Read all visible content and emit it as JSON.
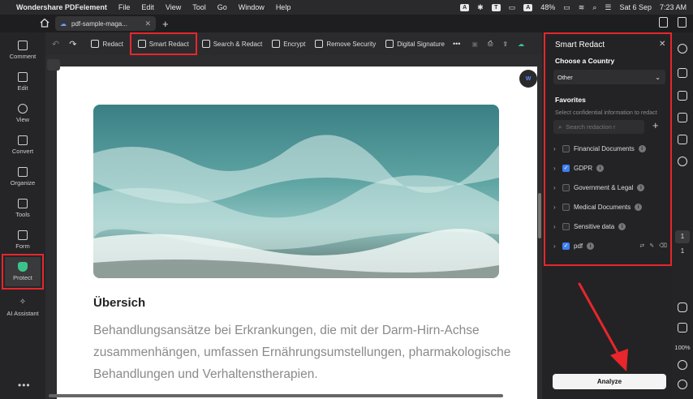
{
  "menubar": {
    "app": "Wondershare PDFelement",
    "items": [
      "File",
      "Edit",
      "View",
      "Tool",
      "Go",
      "Window",
      "Help"
    ],
    "status_a": "A",
    "battery": "48%",
    "datetime_day": "Sat 6 Sep",
    "datetime_time": "7:23 AM"
  },
  "tab": {
    "title": "pdf-sample-maga...",
    "close": "✕",
    "new": "+"
  },
  "sidebar": [
    {
      "label": "Comment"
    },
    {
      "label": "Edit"
    },
    {
      "label": "View"
    },
    {
      "label": "Convert"
    },
    {
      "label": "Organize"
    },
    {
      "label": "Tools"
    },
    {
      "label": "Form"
    },
    {
      "label": "Protect"
    },
    {
      "label": "AI Assistant"
    }
  ],
  "sidebar_more": "•••",
  "toolbar": {
    "redact": "Redact",
    "smart_redact": "Smart Redact",
    "search_redact": "Search & Redact",
    "encrypt": "Encrypt",
    "remove_security": "Remove Security",
    "digital_signature": "Digital Signature",
    "more": "•••"
  },
  "document": {
    "badge": "W",
    "heading": "Übersich",
    "body": "Behandlungsansätze bei Erkrankungen, die mit der Darm-Hirn-Achse zusammenhängen, umfassen Ernährungsumstellungen, pharmakologische Behandlungen und Verhaltenstherapien."
  },
  "panel": {
    "title": "Smart Redact",
    "close": "✕",
    "country_label": "Choose a Country",
    "country_value": "Other",
    "favorites_label": "Favorites",
    "hint": "Select confidential information to redact",
    "search_placeholder": "Search redaction r",
    "add": "+",
    "categories": [
      {
        "label": "Financial Documents",
        "checked": false
      },
      {
        "label": "GDPR",
        "checked": true
      },
      {
        "label": "Government & Legal",
        "checked": false
      },
      {
        "label": "Medical Documents",
        "checked": false
      },
      {
        "label": "Sensitive data",
        "checked": false
      },
      {
        "label": "pdf",
        "checked": true
      }
    ],
    "analyze": "Analyze"
  },
  "right_bar": {
    "page_current": "1",
    "page_total": "1",
    "zoom": "100%"
  },
  "colors": {
    "highlight": "#e8262c",
    "accent_green": "#3cc38a",
    "checkbox_blue": "#3f7ff0"
  }
}
